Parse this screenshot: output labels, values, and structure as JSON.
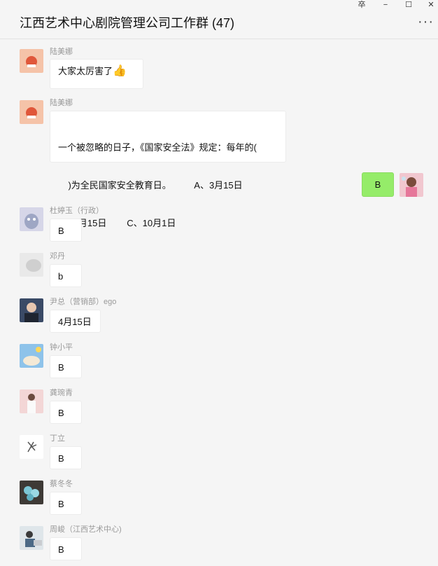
{
  "window": {
    "title": "江西艺术中心剧院管理公司工作群 (47)",
    "controls": [
      "卒",
      "−",
      "☐",
      "✕"
    ],
    "more": "···"
  },
  "messages": [
    {
      "sender": "陆美娜",
      "text": "大家太厉害了",
      "emoji": "👍"
    },
    {
      "sender": "陆美娜",
      "lines": [
        "一个被忽略的日子，《国家安全法》规定：每年的(",
        "    )为全民国家安全教育日。         A、3月15日",
        "B、4月15日        C、10月1日"
      ]
    },
    {
      "sender": "",
      "text": "B",
      "self": true
    },
    {
      "sender": "杜婷玉（行政）",
      "text": "B"
    },
    {
      "sender": "邓丹",
      "text": "b"
    },
    {
      "sender": "尹总（营销部）ego",
      "text": "4月15日"
    },
    {
      "sender": "钟小平",
      "text": "B"
    },
    {
      "sender": " 龚琬青",
      "text": "B"
    },
    {
      "sender": "丁立",
      "text": "B"
    },
    {
      "sender": "蔡冬冬",
      "text": "B"
    },
    {
      "sender": "周峻（江西艺术中心)",
      "text": "B"
    }
  ],
  "colors": {
    "self_bubble": "#95ec69",
    "other_bubble": "#ffffff",
    "background": "#f5f5f5"
  }
}
